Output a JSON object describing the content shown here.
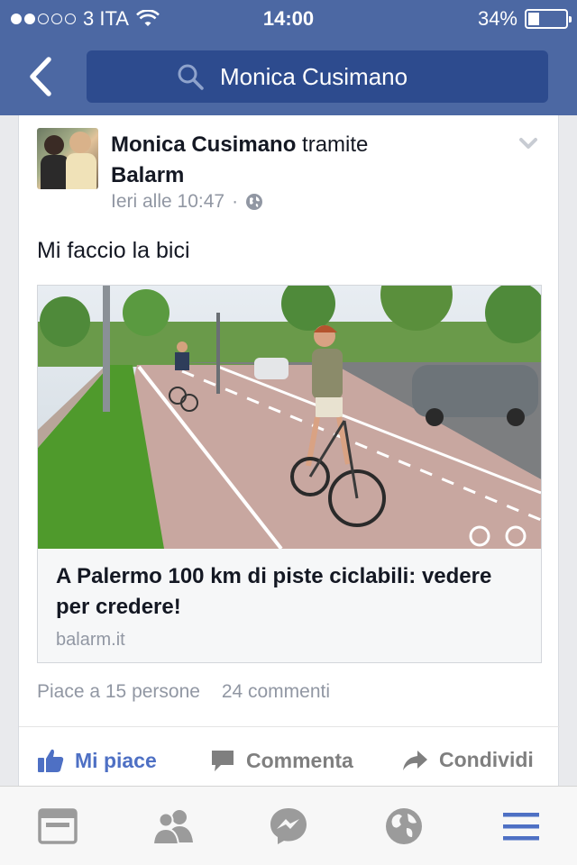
{
  "status_bar": {
    "carrier": "3 ITA",
    "time": "14:00",
    "battery": "34%",
    "signal_bars": 2
  },
  "nav": {
    "search_query": "Monica Cusimano"
  },
  "post": {
    "author": "Monica Cusimano",
    "via_text": "tramite",
    "page": "Balarm",
    "timestamp": "Ieri alle 10:47",
    "message": "Mi faccio la bici",
    "link": {
      "title": "A Palermo 100 km di piste ciclabili: vedere per credere!",
      "domain": "balarm.it"
    },
    "likes_text": "Piace a 15 persone",
    "comments_text": "24 commenti",
    "actions": {
      "like": "Mi piace",
      "comment": "Commenta",
      "share": "Condividi"
    }
  },
  "tab_bar": {
    "icons": [
      "news-feed-icon",
      "friends-icon",
      "messenger-icon",
      "globe-icon",
      "menu-icon"
    ],
    "active_color": "#4e70c4",
    "inactive_color": "#9b9b9b"
  },
  "colors": {
    "header": "#4c68a3",
    "searchbox": "#2d4b8e",
    "accent": "#4e70c4"
  }
}
